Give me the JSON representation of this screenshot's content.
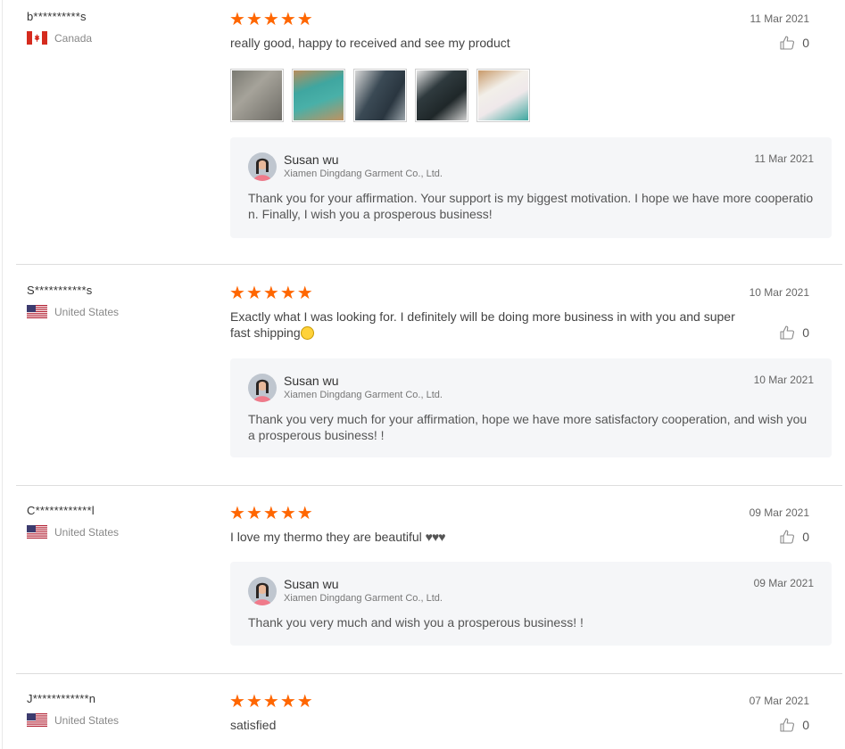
{
  "reviews": [
    {
      "user": "b**********s",
      "country": "Canada",
      "date": "11 Mar 2021",
      "text": "really good, happy to received and see my product",
      "likes": "0",
      "rating": 5,
      "photo_count": 5,
      "reply": {
        "name": "Susan wu",
        "company": "Xiamen Dingdang Garment Co., Ltd.",
        "date": "11 Mar 2021",
        "text": "Thank you for your affirmation. Your support is my biggest motivation. I hope we have more cooperation. Finally, I wish you a prosperous business!"
      }
    },
    {
      "user": "S***********s",
      "country": "United States",
      "date": "10 Mar 2021",
      "text": "Exactly what I was looking for. I definitely will be doing more business in with you and super fast shipping",
      "likes": "0",
      "rating": 5,
      "reply": {
        "name": "Susan wu",
        "company": "Xiamen Dingdang Garment Co., Ltd.",
        "date": "10 Mar 2021",
        "text": "Thank you very much for your affirmation, hope we have more satisfactory cooperation, and wish you a prosperous business! !"
      }
    },
    {
      "user": "C************l",
      "country": "United States",
      "date": "09 Mar 2021",
      "text": "I love my thermo they are beautiful",
      "hearts": "♥♥♥",
      "likes": "0",
      "rating": 5,
      "reply": {
        "name": "Susan wu",
        "company": "Xiamen Dingdang Garment Co., Ltd.",
        "date": "09 Mar 2021",
        "text": "Thank you very much and wish you a prosperous business! !"
      }
    },
    {
      "user": "J************n",
      "country": "United States",
      "date": "07 Mar 2021",
      "text": "satisfied",
      "likes": "0",
      "rating": 5
    }
  ],
  "colors": {
    "star": "#ff6600",
    "reply_bg": "#f5f6f8",
    "divider": "#dddddd"
  },
  "icons": {
    "like": "thumbs-up-icon",
    "star": "star-icon",
    "flag_ca": "canada-flag-icon",
    "flag_us": "us-flag-icon"
  }
}
